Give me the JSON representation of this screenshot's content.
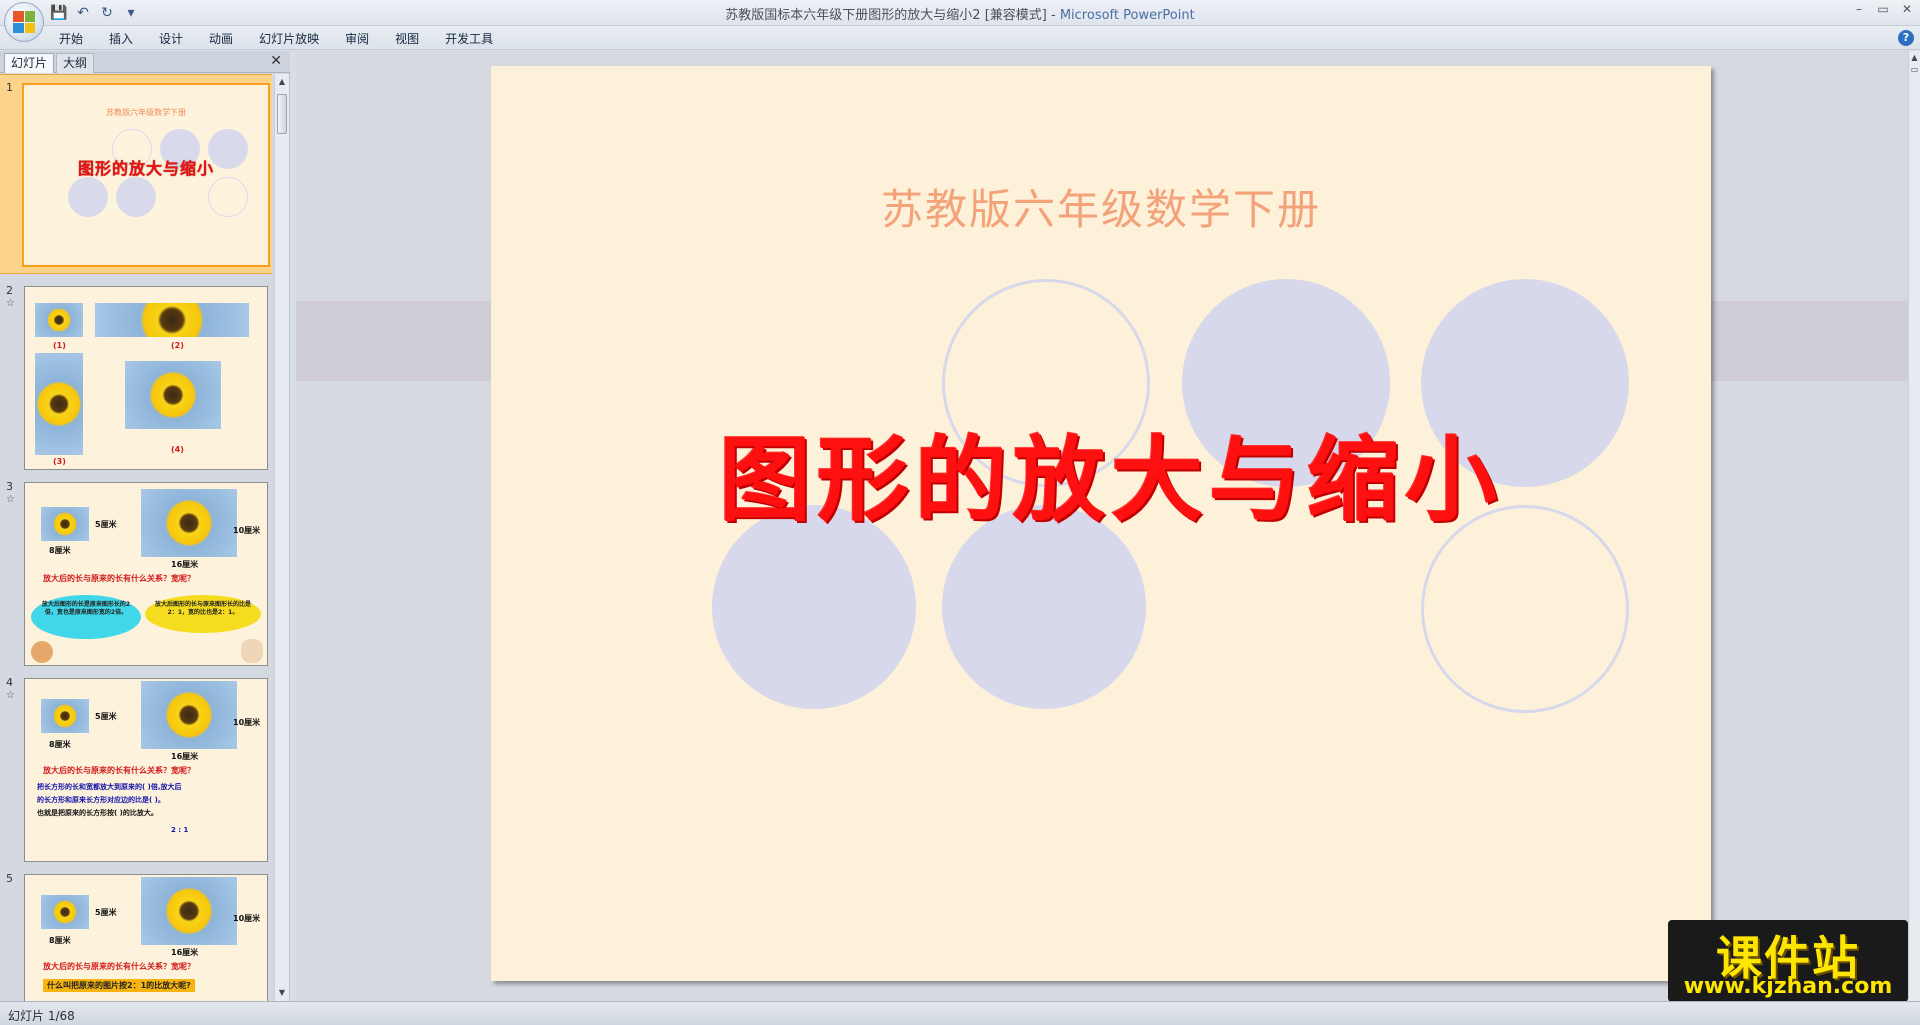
{
  "window": {
    "title_doc": "苏教版国标本六年级下册图形的放大与缩小2 [兼容模式]",
    "title_sep": " - ",
    "title_app": "Microsoft PowerPoint"
  },
  "quick_access": {
    "save": "💾",
    "undo": "↶",
    "redo": "↻",
    "more": "▾"
  },
  "ribbon": {
    "tabs": [
      "开始",
      "插入",
      "设计",
      "动画",
      "幻灯片放映",
      "审阅",
      "视图",
      "开发工具"
    ],
    "help": "?"
  },
  "window_controls": {
    "minimize": "–",
    "restore": "▭",
    "close": "✕"
  },
  "left_pane": {
    "tab_slides": "幻灯片",
    "tab_outline": "大纲",
    "close": "✕",
    "scroll_up": "▲",
    "scroll_down": "▼"
  },
  "thumbnails": [
    {
      "num": "1",
      "subtitle": "苏教版六年级数学下册",
      "title": "图形的放大与缩小"
    },
    {
      "num": "2",
      "captions": [
        "(1)",
        "(2)",
        "(3)",
        "(4)"
      ]
    },
    {
      "num": "3",
      "w1": "5厘米",
      "h1": "8厘米",
      "w2": "10厘米",
      "h2": "16厘米",
      "question": "放大后的长与原来的长有什么关系？宽呢？",
      "bubble_left": "放大后图形的长是原来图形长的2倍，宽也是原来图形宽的2倍。",
      "bubble_right": "放大后图形的长与原来图形长的比是2：1，宽的比也是2：1。"
    },
    {
      "num": "4",
      "w1": "5厘米",
      "h1": "8厘米",
      "w2": "10厘米",
      "h2": "16厘米",
      "question": "放大后的长与原来的长有什么关系？宽呢？",
      "text1": "把长方形的长和宽都放大到原来的( )倍,放大后",
      "text2": "的长方形和原来长方形对应边的比是(      )。",
      "text3": "也就是把原来的长方形按(      )的比放大。",
      "answer": "2 : 1"
    },
    {
      "num": "5",
      "w1": "5厘米",
      "h1": "8厘米",
      "w2": "10厘米",
      "h2": "16厘米",
      "question": "放大后的长与原来的长有什么关系？宽呢？",
      "highlight": "什么叫把原来的图片按2：1的比放大呢?"
    }
  ],
  "slide": {
    "subtitle": "苏教版六年级数学下册",
    "title": "图形的放大与缩小",
    "colors": {
      "background": "#fdf2d9",
      "circle": "#d8d8ec",
      "title": "#ff1010",
      "subtitle": "#f3a27a"
    }
  },
  "status_bar": {
    "slide_info": "幻灯片 1/68"
  },
  "watermark": {
    "main": "课件站",
    "url": "www.kjzhan.com"
  }
}
